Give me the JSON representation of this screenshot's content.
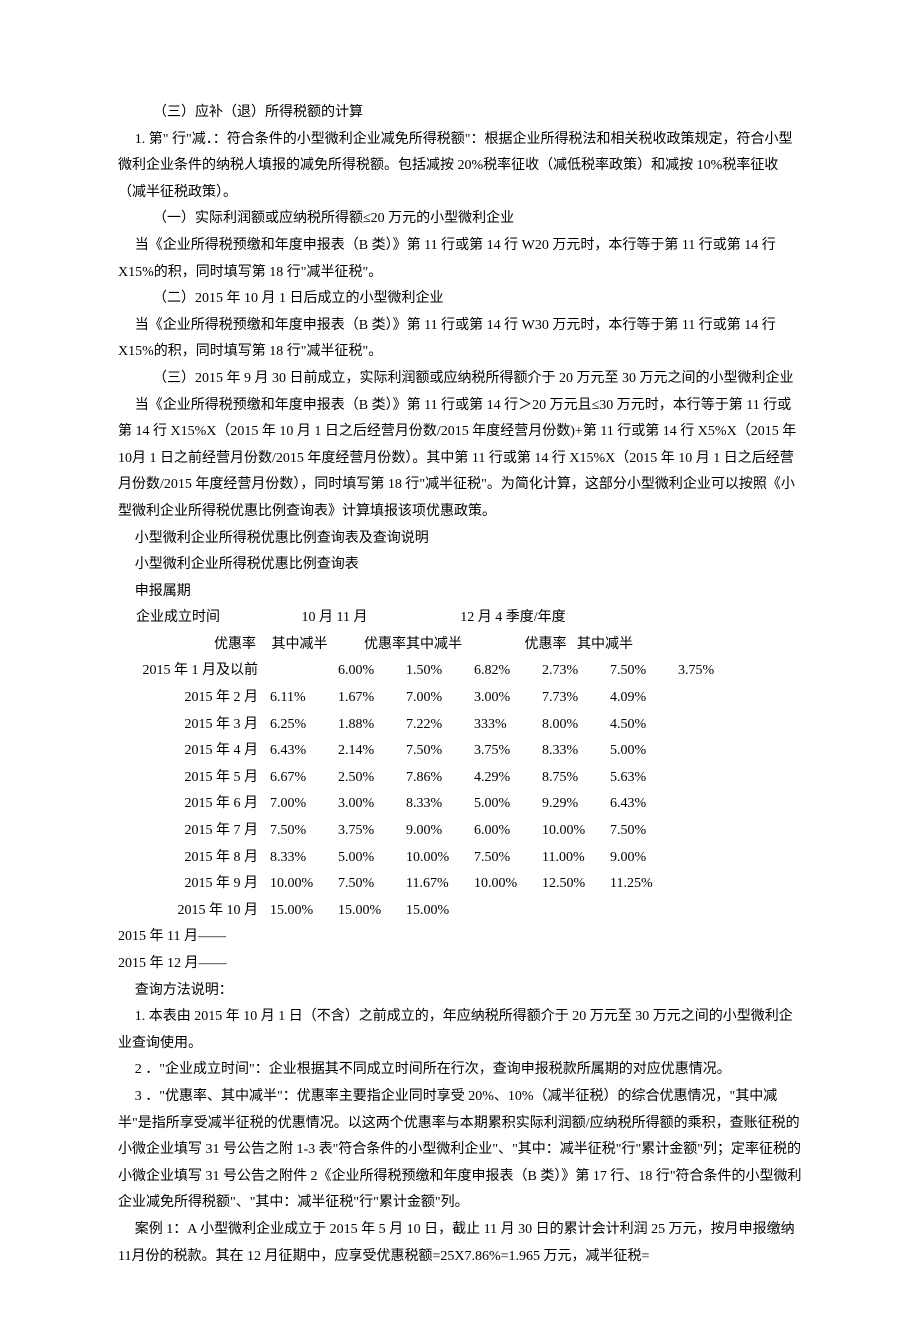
{
  "p": {
    "s3title": "（三）应补（退）所得税额的计算",
    "p1": "1. 第\" 行\"减．：符合条件的小型微利企业减免所得税额\"：根据企业所得税法和相关税收政策规定，符合小型微利企业条件的纳税人填报的减免所得税额。包括减按 20%税率征收（减低税率政策）和减按 10%税率征收（减半征税政策）。",
    "s1": "（一）实际利润额或应纳税所得额≤20 万元的小型微利企业",
    "p2": "当《企业所得税预缴和年度申报表（B 类）》第 11 行或第 14 行 W20 万元时，本行等于第 11 行或第 14 行 X15%的积，同时填写第 18 行\"减半征税\"。",
    "s2": "（二）2015 年 10 月 1 日后成立的小型微利企业",
    "p3": "当《企业所得税预缴和年度申报表（B 类）》第 11 行或第 14 行 W30 万元时，本行等于第 11 行或第 14 行 X15%的积，同时填写第 18 行\"减半征税\"。",
    "s3": "（三）2015 年 9 月 30 日前成立，实际利润额或应纳税所得额介于 20 万元至 30 万元之间的小型微利企业",
    "p4": "当《企业所得税预缴和年度申报表（B 类）》第 11 行或第 14 行＞20 万元且≤30 万元时，本行等于第 11 行或第 14 行 X15%X（2015 年 10 月 1 日之后经营月份数/2015 年度经营月份数)+第 11 行或第 14 行 X5%X（2015 年 10月 1 日之前经营月份数/2015 年度经营月份数）。其中第 11 行或第 14 行 X15%X（2015 年 10 月 1 日之后经营月份数/2015 年度经营月份数），同时填写第 18 行\"减半征税\"。为简化计算，这部分小型微利企业可以按照《小型微利企业所得税优惠比例查询表》计算填报该项优惠政策。",
    "t1": "小型微利企业所得税优惠比例查询表及查询说明",
    "t2": "小型微利企业所得税优惠比例查询表",
    "t3": "申报属期",
    "hdr1_a": "企业成立时间",
    "hdr1_b": "10 月 11 月",
    "hdr1_c": "12 月 4 季度/年度",
    "hdr2_y1": "优惠率",
    "hdr2_j1": "其中减半",
    "hdr2_y2": "优惠率其中减半",
    "hdr2_y3": "优惠率",
    "hdr2_j3": "其中减半",
    "rows": [
      {
        "label": "2015 年 1 月及以前",
        "c1": "",
        "c2": "6.00%",
        "c3": "1.50%",
        "c4": "6.82%",
        "c5": "2.73%",
        "c6": "7.50%",
        "c7": "3.75%"
      },
      {
        "label": "2015 年 2 月",
        "c1": "6.11%",
        "c2": "1.67%",
        "c3": "7.00%",
        "c4": "3.00%",
        "c5": "7.73%",
        "c6": "4.09%",
        "c7": ""
      },
      {
        "label": "2015 年 3 月",
        "c1": "6.25%",
        "c2": "1.88%",
        "c3": "7.22%",
        "c4": "333%",
        "c5": "8.00%",
        "c6": "4.50%",
        "c7": ""
      },
      {
        "label": "2015 年 4 月",
        "c1": "6.43%",
        "c2": "2.14%",
        "c3": "7.50%",
        "c4": "3.75%",
        "c5": "8.33%",
        "c6": "5.00%",
        "c7": ""
      },
      {
        "label": "2015 年 5 月",
        "c1": "6.67%",
        "c2": "2.50%",
        "c3": "7.86%",
        "c4": "4.29%",
        "c5": "8.75%",
        "c6": "5.63%",
        "c7": ""
      },
      {
        "label": "2015 年 6 月",
        "c1": "7.00%",
        "c2": "3.00%",
        "c3": "8.33%",
        "c4": "5.00%",
        "c5": "9.29%",
        "c6": "6.43%",
        "c7": ""
      },
      {
        "label": "2015 年 7 月",
        "c1": "7.50%",
        "c2": "3.75%",
        "c3": "9.00%",
        "c4": "6.00%",
        "c5": "10.00%",
        "c6": "7.50%",
        "c7": ""
      },
      {
        "label": "2015 年 8 月",
        "c1": "8.33%",
        "c2": "5.00%",
        "c3": "10.00%",
        "c4": "7.50%",
        "c5": "11.00%",
        "c6": "9.00%",
        "c7": ""
      },
      {
        "label": "2015 年 9 月",
        "c1": "10.00%",
        "c2": "7.50%",
        "c3": "11.67%",
        "c4": "10.00%",
        "c5": "12.50%",
        "c6": "11.25%",
        "c7": ""
      },
      {
        "label": "2015 年 10 月",
        "c1": "15.00%",
        "c2": "15.00%",
        "c3": "15.00%",
        "c4": "",
        "c5": "",
        "c6": "",
        "c7": ""
      }
    ],
    "r11": "2015 年 11 月——",
    "r12": "2015 年 12 月——",
    "q0": "查询方法说明：",
    "q1": "1. 本表由 2015 年 10 月 1 日（不含）之前成立的，年应纳税所得额介于 20 万元至 30 万元之间的小型微利企业查询使用。",
    "q2": "2 ．\"企业成立时间\"：企业根据其不同成立时间所在行次，查询申报税款所属期的对应优惠情况。",
    "q3": "3 ．\"优惠率、其中减半\"：优惠率主要指企业同时享受 20%、10%（减半征税）的综合优惠情况，\"其中减半\"是指所享受减半征税的优惠情况。以这两个优惠率与本期累积实际利润额/应纳税所得额的乘积，查账征税的小微企业填写 31 号公告之附 1-3 表\"符合条件的小型微利企业\"、\"其中：减半征税\"行\"累计金额\"列；定率征税的小微企业填写 31 号公告之附件 2《企业所得税预缴和年度申报表（B 类）》第 17 行、18 行\"符合条件的小型微利企业减免所得税额\"、\"其中：减半征税\"行\"累计金额\"列。",
    "case1": "案例 1：A 小型微利企业成立于 2015 年 5 月 10 日，截止 11 月 30 日的累计会计利润 25 万元，按月申报缴纳 11月份的税款。其在 12 月征期中，应享受优惠税额=25X7.86%=1.965 万元，减半征税="
  },
  "chart_data": {
    "type": "table",
    "title": "小型微利企业所得税优惠比例查询表",
    "columns": [
      "企业成立时间",
      "10月 优惠率",
      "10月 其中减半",
      "11月 优惠率",
      "11月 其中减半",
      "12月/4季度/年度 优惠率",
      "12月/4季度/年度 其中减半"
    ],
    "rows": [
      [
        "2015 年 1 月及以前",
        "6.00%",
        "1.50%",
        "6.82%",
        "2.73%",
        "7.50%",
        "3.75%"
      ],
      [
        "2015 年 2 月",
        "6.11%",
        "1.67%",
        "7.00%",
        "3.00%",
        "7.73%",
        "4.09%"
      ],
      [
        "2015 年 3 月",
        "6.25%",
        "1.88%",
        "7.22%",
        "333%",
        "8.00%",
        "4.50%"
      ],
      [
        "2015 年 4 月",
        "6.43%",
        "2.14%",
        "7.50%",
        "3.75%",
        "8.33%",
        "5.00%"
      ],
      [
        "2015 年 5 月",
        "6.67%",
        "2.50%",
        "7.86%",
        "4.29%",
        "8.75%",
        "5.63%"
      ],
      [
        "2015 年 6 月",
        "7.00%",
        "3.00%",
        "8.33%",
        "5.00%",
        "9.29%",
        "6.43%"
      ],
      [
        "2015 年 7 月",
        "7.50%",
        "3.75%",
        "9.00%",
        "6.00%",
        "10.00%",
        "7.50%"
      ],
      [
        "2015 年 8 月",
        "8.33%",
        "5.00%",
        "10.00%",
        "7.50%",
        "11.00%",
        "9.00%"
      ],
      [
        "2015 年 9 月",
        "10.00%",
        "7.50%",
        "11.67%",
        "10.00%",
        "12.50%",
        "11.25%"
      ],
      [
        "2015 年 10 月",
        "15.00%",
        "15.00%",
        "15.00%",
        "",
        "",
        ""
      ],
      [
        "2015 年 11 月",
        "——",
        "",
        "",
        "",
        "",
        ""
      ],
      [
        "2015 年 12 月",
        "——",
        "",
        "",
        "",
        "",
        ""
      ]
    ]
  }
}
